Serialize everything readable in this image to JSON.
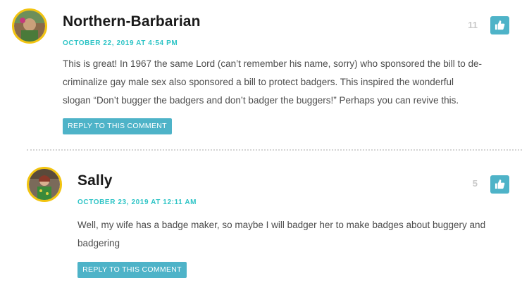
{
  "comments": [
    {
      "author": "Northern-Barbarian",
      "timestamp": "OCTOBER 22, 2019 AT 4:54 PM",
      "body_line1": "This is great! In 1967 the same Lord (can’t remember his name, sorry) who sponsored the bill to de-",
      "body_line2": "criminalize gay male sex also sponsored a bill to protect badgers. This inspired the wonderful",
      "body_line3": "slogan “Don’t bugger the badgers and don’t badger the buggers!” Perhaps you can revive this.",
      "like_count": "11",
      "reply_label": "REPLY TO THIS COMMENT",
      "avatar_icon": "user-avatar-photo",
      "like_icon": "thumbs-up-icon"
    },
    {
      "author": "Sally",
      "timestamp": "OCTOBER 23, 2019 AT 12:11 AM",
      "body_line1": "Well, my wife has a badge maker, so maybe I will badger her to make badges about buggery and",
      "body_line2": "badgering",
      "like_count": "5",
      "reply_label": "REPLY TO THIS COMMENT",
      "avatar_icon": "user-avatar-photo",
      "like_icon": "thumbs-up-icon"
    }
  ],
  "colors": {
    "accent": "#4eb3c8",
    "timestamp": "#2ec4c6",
    "avatar_border": "#f2c40f",
    "body_text": "#4d4d4d",
    "author_text": "#1a1a1a"
  }
}
